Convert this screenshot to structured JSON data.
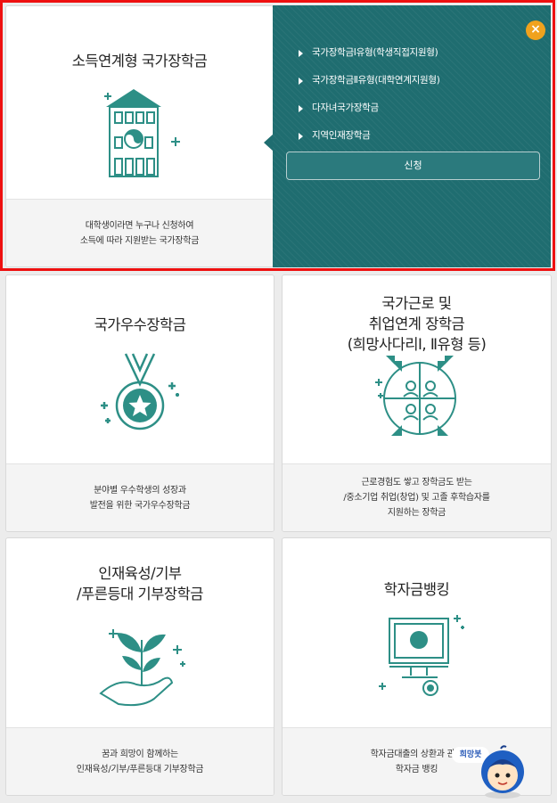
{
  "cards": {
    "income": {
      "title": "소득연계형 국가장학금",
      "desc_line1": "대학생이라면 누구나 신청하여",
      "desc_line2": "소득에 따라 지원받는 국가장학금",
      "icon": "school-building-icon"
    },
    "excellence": {
      "title": "국가우수장학금",
      "desc_line1": "분야별 우수학생의 성장과",
      "desc_line2": "발전을 위한 국가우수장학금",
      "icon": "medal-star-icon"
    },
    "work": {
      "title_line1": "국가근로 및",
      "title_line2": "취업연계 장학금",
      "title_line3": "(희망사다리Ⅰ, Ⅱ유형 등)",
      "desc_line1": "근로경험도 쌓고 장학금도 받는",
      "desc_line2": "/중소기업 취업(창업) 및 고졸 후학습자를",
      "desc_line3": "지원하는 장학금",
      "icon": "people-network-icon"
    },
    "donation": {
      "title_line1": "인재육성/기부",
      "title_line2": "/푸른등대 기부장학금",
      "desc_line1": "꿈과 희망이 함께하는",
      "desc_line2": "인재육성/기부/푸른등대 기부장학금",
      "icon": "sprout-hand-icon"
    },
    "banking": {
      "title": "학자금뱅킹",
      "desc_line1": "학자금대출의 상환과 관리",
      "desc_line2": "학자금 뱅킹",
      "icon": "monitor-coin-icon"
    }
  },
  "popup": {
    "items": [
      "국가장학금Ⅰ유형(학생직접지원형)",
      "국가장학금Ⅱ유형(대학연계지원형)",
      "다자녀국가장학금",
      "지역인재장학금"
    ],
    "apply_label": "신청",
    "close_glyph": "×"
  },
  "chatbot": {
    "label": "희망봇"
  },
  "colors": {
    "teal": "#1f6d70",
    "icon_teal": "#2d8f86",
    "highlight": "#ee1010",
    "close": "#f0a21e"
  }
}
